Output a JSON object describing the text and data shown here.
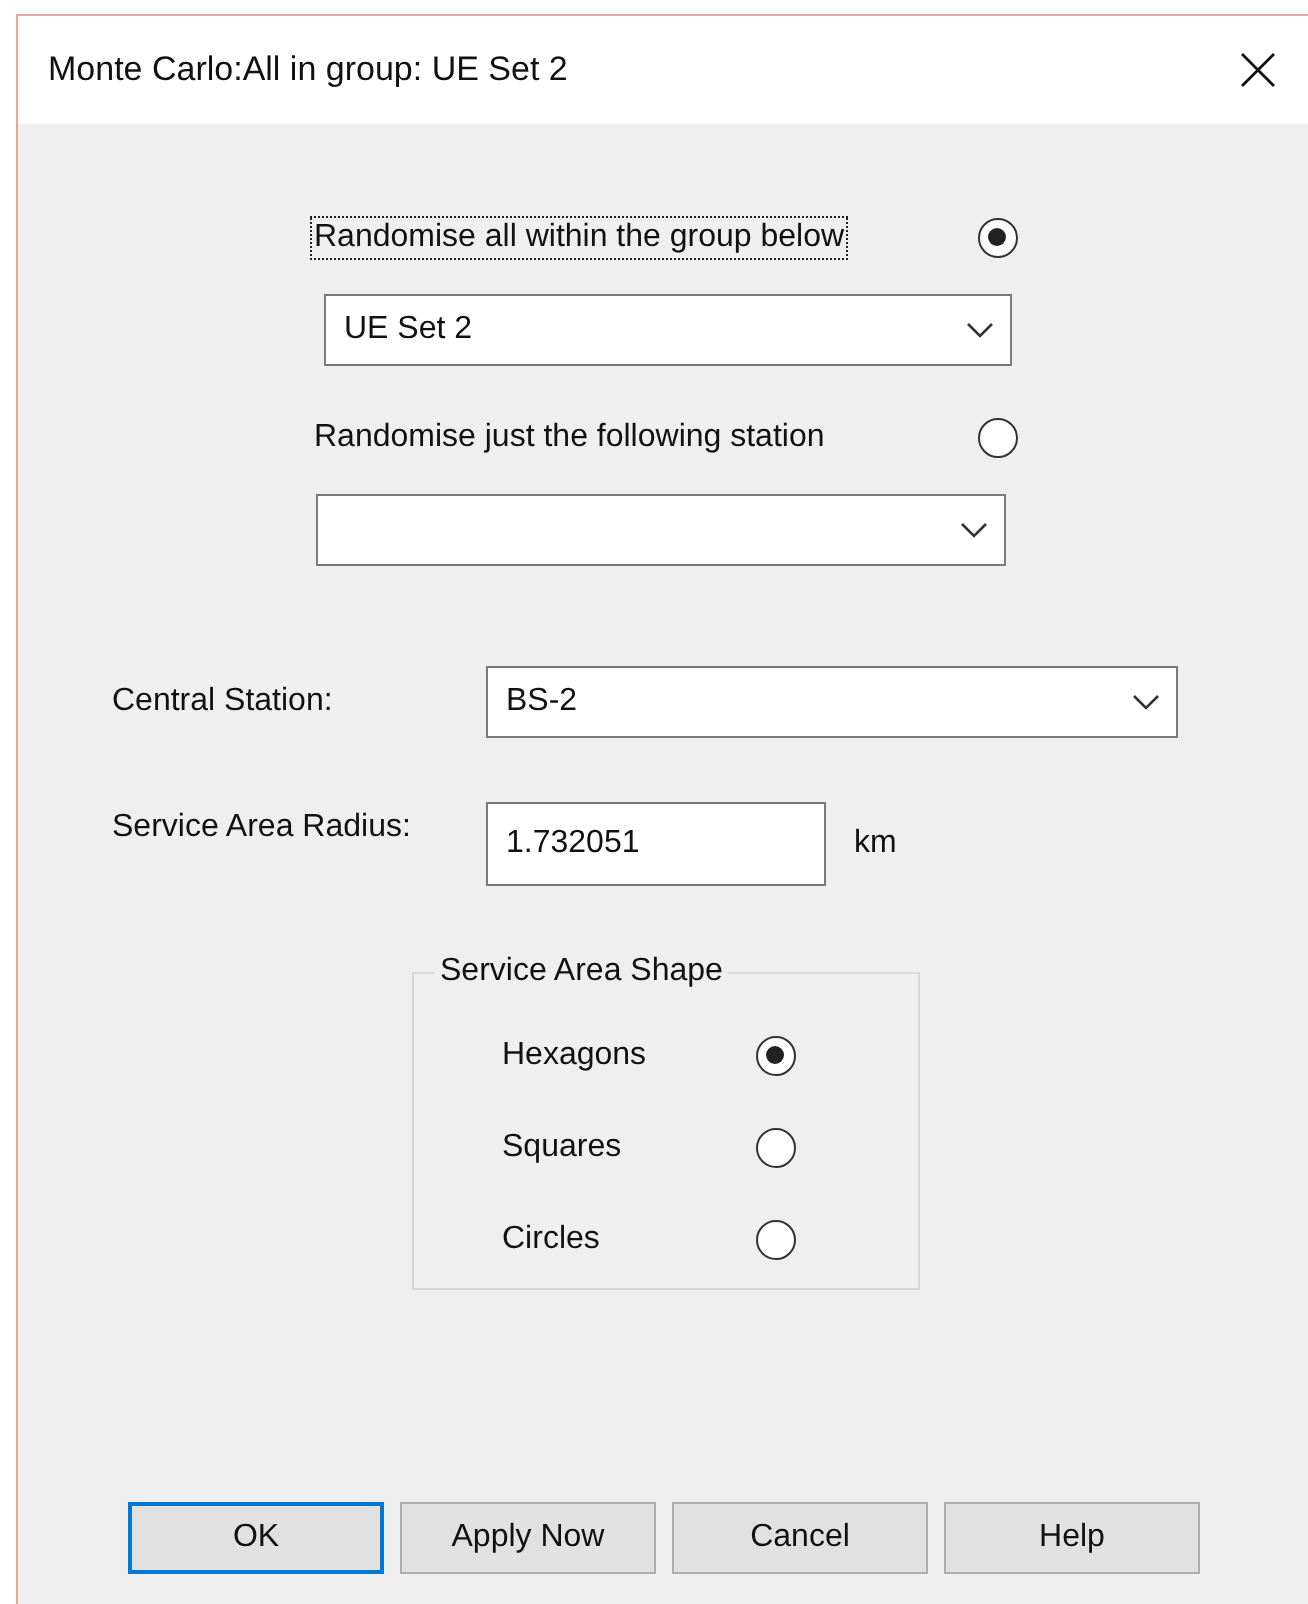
{
  "window": {
    "title": "Monte Carlo:All in group: UE Set 2"
  },
  "scope_options": [
    {
      "label": "Randomise all within the group below",
      "selected": true,
      "focused": true,
      "dropdown_value": "UE Set 2"
    },
    {
      "label": "Randomise just the following station",
      "selected": false,
      "focused": false
    }
  ],
  "central_station": {
    "label": "Central Station:",
    "value": "BS-2"
  },
  "service_area_radius": {
    "label": "Service Area Radius:",
    "value": "1.732051",
    "unit": "km"
  },
  "service_area_shape": {
    "title": "Service Area Shape",
    "options": [
      {
        "label": "Hexagons",
        "selected": true
      },
      {
        "label": "Squares",
        "selected": false
      },
      {
        "label": "Circles",
        "selected": false
      }
    ]
  },
  "buttons": [
    {
      "label": "OK",
      "default": true
    },
    {
      "label": "Apply Now",
      "default": false
    },
    {
      "label": "Cancel",
      "default": false
    },
    {
      "label": "Help",
      "default": false
    }
  ]
}
